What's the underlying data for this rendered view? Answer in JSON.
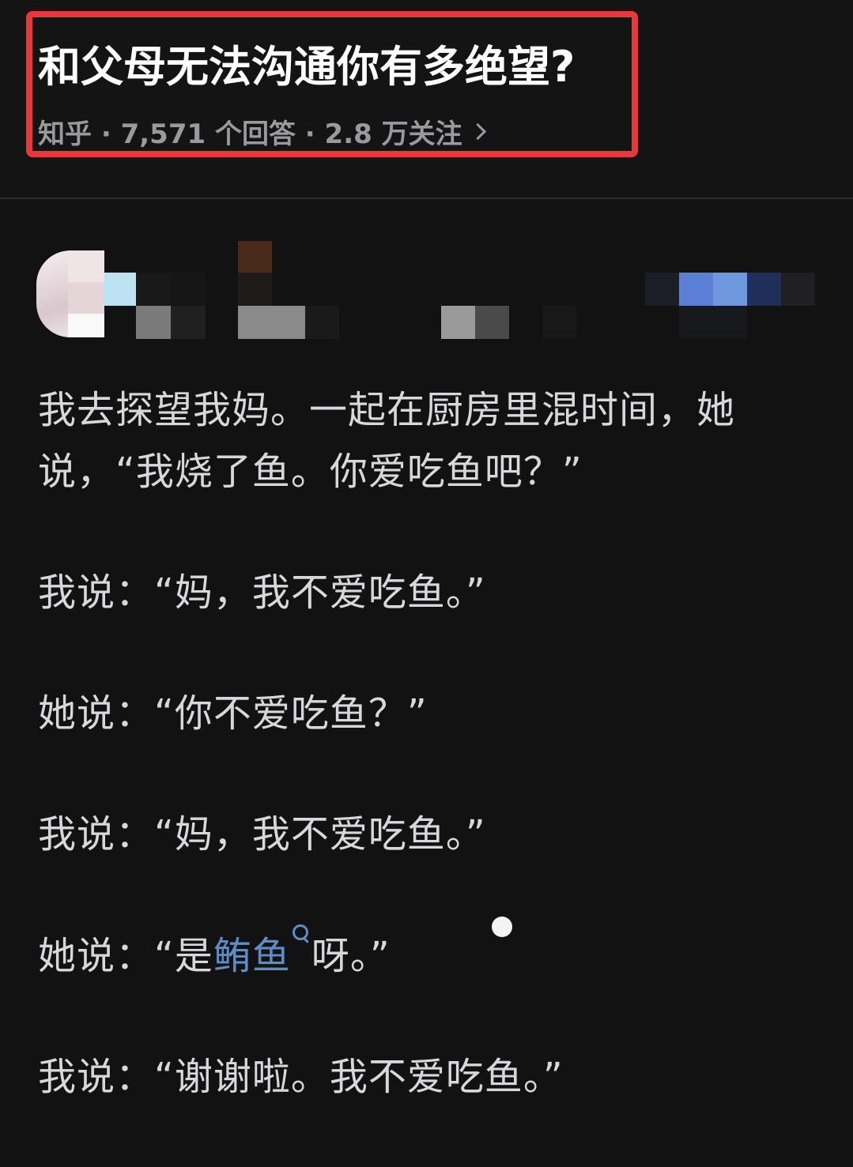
{
  "question": {
    "title": "和父母无法沟通你有多绝望?",
    "meta": "知乎 · 7,571 个回答 · 2.8 万关注"
  },
  "answer": {
    "paragraphs": [
      "我去探望我妈。一起在厨房里混时间，她说，“我烧了鱼。你爱吃鱼吧？”",
      "我说：“妈，我不爱吃鱼。”",
      "她说：“你不爱吃鱼？”",
      "我说：“妈，我不爱吃鱼。”"
    ],
    "p5_prefix": "她说：“是",
    "p5_link": "鲔鱼",
    "p5_suffix": "呀。”",
    "p6": "我说：“谢谢啦。我不爱吃鱼。”"
  },
  "colors": {
    "highlight": "#e8383b",
    "link": "#5e8dc4",
    "background": "#121213"
  },
  "icons": {
    "search": "search-icon",
    "chevron": "chevron-right-icon"
  }
}
